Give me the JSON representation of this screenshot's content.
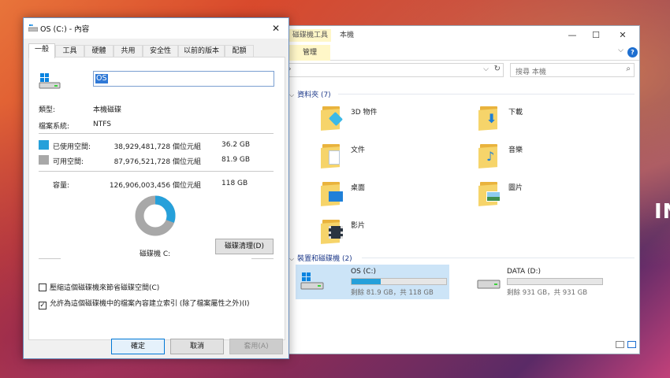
{
  "wallpaper": {
    "text": "IN"
  },
  "explorer": {
    "ribbon_context_tab": "磁碟機工具",
    "title": "本機",
    "window_buttons": {
      "minimize": "—",
      "maximize": "☐",
      "close": "✕"
    },
    "manage_tab": "管理",
    "address_arrow": "›",
    "search_placeholder": "搜尋 本機",
    "groups": {
      "folders": {
        "label": "資料夾 (7)"
      },
      "drives": {
        "label": "裝置和磁碟機 (2)"
      }
    },
    "folders": [
      {
        "label": "3D 物件",
        "icon": "3d-objects-folder-icon"
      },
      {
        "label": "下載",
        "icon": "downloads-folder-icon"
      },
      {
        "label": "文件",
        "icon": "documents-folder-icon"
      },
      {
        "label": "音樂",
        "icon": "music-folder-icon"
      },
      {
        "label": "桌面",
        "icon": "desktop-folder-icon"
      },
      {
        "label": "圖片",
        "icon": "pictures-folder-icon"
      },
      {
        "label": "影片",
        "icon": "videos-folder-icon"
      }
    ],
    "drives": [
      {
        "name": "OS (C:)",
        "free": "剩餘 81.9 GB，共 118 GB",
        "used_fraction": 0.31,
        "selected": true
      },
      {
        "name": "DATA (D:)",
        "free": "剩餘 931 GB，共 931 GB",
        "used_fraction": 0.0,
        "selected": false
      }
    ]
  },
  "props": {
    "title": "OS (C:) - 內容",
    "close": "✕",
    "tabs": [
      "一般",
      "工具",
      "硬體",
      "共用",
      "安全性",
      "以前的版本",
      "配額"
    ],
    "name_value": "OS",
    "type_label": "類型:",
    "type_value": "本機磁碟",
    "fs_label": "檔案系統:",
    "fs_value": "NTFS",
    "used": {
      "label": "已使用空間:",
      "bytes": "38,929,481,728 個位元組",
      "gb": "36.2 GB",
      "color": "#26a0da"
    },
    "free": {
      "label": "可用空間:",
      "bytes": "87,976,521,728 個位元組",
      "gb": "81.9 GB",
      "color": "#a8a8a8"
    },
    "capacity": {
      "label": "容量:",
      "bytes": "126,906,003,456 個位元組",
      "gb": "118 GB"
    },
    "drive_label": "磁碟機 C:",
    "cleanup_button": "磁碟清理(D)",
    "compress_label": "壓縮這個磁碟機來節省磁碟空間(C)",
    "compress_checked": false,
    "index_label": "允許為這個磁碟機中的檔案內容建立索引 (除了檔案屬性之外)(I)",
    "index_checked": true,
    "checkmark": "✓",
    "ok_button": "確定",
    "cancel_button": "取消",
    "apply_button": "套用(A)"
  }
}
